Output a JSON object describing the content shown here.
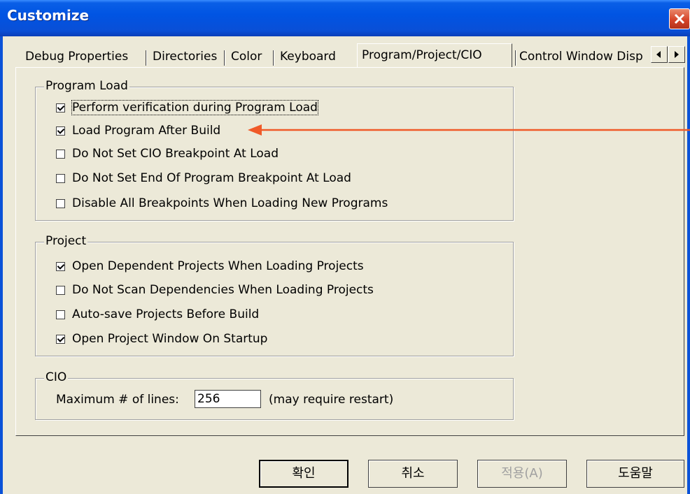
{
  "window": {
    "title": "Customize"
  },
  "tabs": [
    "Debug Properties",
    "Directories",
    "Color",
    "Keyboard",
    "Program/Project/CIO",
    "Control Window Disp"
  ],
  "program_load": {
    "label": "Program Load",
    "items": [
      {
        "text": "Perform verification during Program Load",
        "checked": true
      },
      {
        "text": "Load Program After Build",
        "checked": true
      },
      {
        "text": "Do Not Set CIO Breakpoint At Load",
        "checked": false
      },
      {
        "text": "Do Not Set End Of Program Breakpoint At Load",
        "checked": false
      },
      {
        "text": "Disable All Breakpoints When Loading New Programs",
        "checked": false
      }
    ]
  },
  "project": {
    "label": "Project",
    "items": [
      {
        "text": "Open Dependent Projects When Loading Projects",
        "checked": true
      },
      {
        "text": "Do Not Scan Dependencies When Loading Projects",
        "checked": false
      },
      {
        "text": "Auto-save Projects Before Build",
        "checked": false
      },
      {
        "text": "Open Project Window On Startup",
        "checked": true
      }
    ]
  },
  "cio": {
    "label": "CIO",
    "max_lines_label": "Maximum # of lines:",
    "max_lines_value": "256",
    "note": "(may require restart)"
  },
  "buttons": {
    "ok": "확인",
    "cancel": "취소",
    "apply": "적용(A)",
    "help": "도움말"
  },
  "colors": {
    "arrow": "#f05a28",
    "titlebar": "#0054e3"
  }
}
